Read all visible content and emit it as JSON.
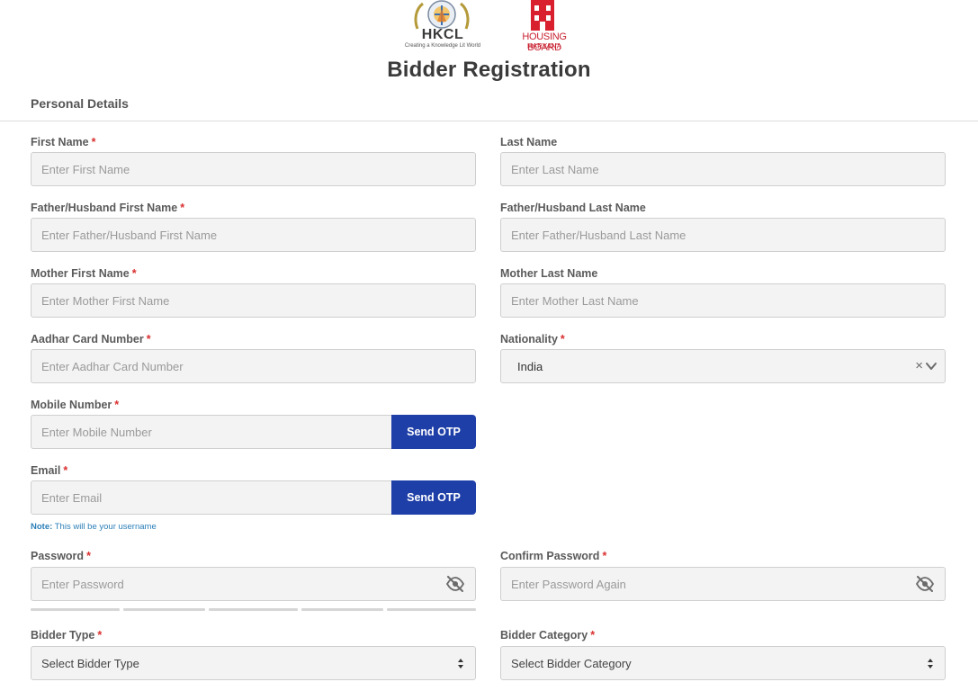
{
  "header": {
    "hkcl_logo_text": "HKCL",
    "hkcl_tagline": "Creating a Knowledge Lit World",
    "hbh_logo_line1": "HOUSING BOARD",
    "hbh_logo_line2": "HARYANA",
    "page_title": "Bidder Registration"
  },
  "section": {
    "title": "Personal Details"
  },
  "fields": {
    "first_name": {
      "label": "First Name",
      "required": "*",
      "placeholder": "Enter First Name"
    },
    "last_name": {
      "label": "Last Name",
      "placeholder": "Enter Last Name"
    },
    "father_first": {
      "label": "Father/Husband First Name",
      "required": "*",
      "placeholder": "Enter Father/Husband First Name"
    },
    "father_last": {
      "label": "Father/Husband Last Name",
      "placeholder": "Enter Father/Husband Last Name"
    },
    "mother_first": {
      "label": "Mother First Name",
      "required": "*",
      "placeholder": "Enter Mother First Name"
    },
    "mother_last": {
      "label": "Mother Last Name",
      "placeholder": "Enter Mother Last Name"
    },
    "aadhar": {
      "label": "Aadhar Card Number",
      "required": "*",
      "placeholder": "Enter Aadhar Card Number"
    },
    "nationality": {
      "label": "Nationality",
      "required": "*",
      "value": "India",
      "clear": "×"
    },
    "mobile": {
      "label": "Mobile Number",
      "required": "*",
      "placeholder": "Enter Mobile Number",
      "button": "Send OTP"
    },
    "email": {
      "label": "Email",
      "required": "*",
      "placeholder": "Enter Email",
      "button": "Send OTP",
      "note_label": "Note:",
      "note_text": "This will be your username"
    },
    "password": {
      "label": "Password",
      "required": "*",
      "placeholder": "Enter Password"
    },
    "confirm_password": {
      "label": "Confirm Password",
      "required": "*",
      "placeholder": "Enter Password Again"
    },
    "bidder_type": {
      "label": "Bidder Type",
      "required": "*",
      "value": "Select Bidder Type"
    },
    "bidder_category": {
      "label": "Bidder Category",
      "required": "*",
      "value": "Select Bidder Category"
    }
  },
  "colors": {
    "primary_button": "#1f3fa8",
    "required_mark": "#d9302f",
    "note": "#2c7fb8"
  },
  "icons": {
    "password_toggle": "eye-slash-icon",
    "dropdown": "chevron-down-icon",
    "clear": "close-icon"
  }
}
